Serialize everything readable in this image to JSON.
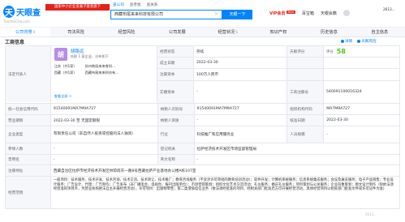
{
  "header": {
    "logo_mark": "天",
    "logo_text": "天眼查",
    "logo_sub": "TianYanCha.com",
    "promo": "国家中小企业发展子基金旗下",
    "search_tabs": [
      "查公司",
      "查老板",
      "查关系"
    ],
    "search_value": "西藏布尾来来科技有限公司",
    "search_clear": "×",
    "search_button": "天眼一下",
    "nav": {
      "vip": "VIP会员",
      "vip_badge": "New",
      "business": "百宝箱",
      "app": "天眼会籍",
      "user": "2613..."
    }
  },
  "tabs": [
    {
      "label": "公司背景",
      "count": "0"
    },
    {
      "label": "司法风险",
      "count": ""
    },
    {
      "label": "经营风险",
      "count": ""
    },
    {
      "label": "公司发展",
      "count": ""
    },
    {
      "label": "经营状况",
      "count": "6"
    },
    {
      "label": "知识产权",
      "count": ""
    },
    {
      "label": "历史信息",
      "count": ""
    },
    {
      "label": "自主信息",
      "count": ""
    }
  ],
  "section": {
    "title": "工商信息",
    "actions": [
      "详情",
      "天眼风险"
    ]
  },
  "rep": {
    "avatar": "胡",
    "name": "胡路远",
    "tags": "任职 1 家企业，分布如下",
    "lines": [
      {
        "province": "江苏",
        "count": "（共1家）",
        "role": "苏州南局来来育科..."
      },
      {
        "province": "西藏",
        "count": "（共1家）",
        "role": "西藏布尾来来科技有..."
      }
    ],
    "more": "查看全部 >"
  },
  "table": {
    "legal_rep_label": "法定代表人",
    "status_label": "经营状态",
    "status_value": "存续",
    "score_label": "天眼评分",
    "score_value": "58",
    "score_unit": "评分",
    "est_date_label": "成立日期",
    "est_date_value": "2022-03-30",
    "reg_capital_label": "注册资本",
    "reg_capital_value": "100万人民币",
    "paid_capital_label": "实缴资本",
    "paid_capital_value": "-",
    "credit_code_label": "统一社会信用代码",
    "credit_code_value": "91540091MA7M9A727",
    "reg_no_label": "工商注册号",
    "reg_no_value": "540091100016324",
    "tax_no_label": "纳税人识别号",
    "tax_no_value": "91540091MA7M9A727",
    "org_code_label": "组织机构代码",
    "org_code_value": "MA7M9A727",
    "term_label": "营业期限",
    "term_value": "2022-03-30 至 无固定期限",
    "taxpayer_label": "纳税人资质",
    "taxpayer_value": "-",
    "approve_label": "核准日期",
    "approve_value": "2022-03-30",
    "type_label": "企业类型",
    "type_value": "有限责任公司（非自然人投资或控股的法人独资）",
    "industry_label": "行业",
    "industry_value": "科技推广和应用服务业",
    "staff_label": "人员规模",
    "staff_value": "-",
    "insured_label": "参保人数",
    "insured_value": "-",
    "reg_org_label": "登记机关",
    "reg_org_value": "拉萨经济技术开发区市场监督管理局",
    "former_label": "曾用名",
    "former_value": "-",
    "en_name_label": "英文名称",
    "en_name_value": "-",
    "address_label": "注册地址",
    "address_value": "西藏自治区拉萨市经济技术开发区林琼岗东一路8号西藏拉萨产业基地办公楼A栋107室",
    "scope_label": "经营范围",
    "scope_value": "一般项目：技术服务、技术开发、技术咨询、技术交流、技术转让、技术推广；教育咨询服务（不含涉许可审批的教育培训活动）；软件开发；计算机系统服务；信息系统集成服务；会议及展览服务；电子产品销售；专业设计服务；广告设计、代理；广告制作；广告发布（非广播电台、电视台、报刊出版单位）；市场营销策划；组织文化艺术交流活动；礼仪服务；婚庆礼仪服务；项目策划与公关服务；企业形象策划；图文设计制作（除依法须经批准的项目外，凭营业执照依法自主开展经营活动）。许可项目：出版物零售；第二类增值电信业务（依法须经批准的项目，经相关部门批准后方可开展经营活动，具体经营项目以相关部门批准文件或许可证件为准）"
  },
  "footer_id": "2613..."
}
